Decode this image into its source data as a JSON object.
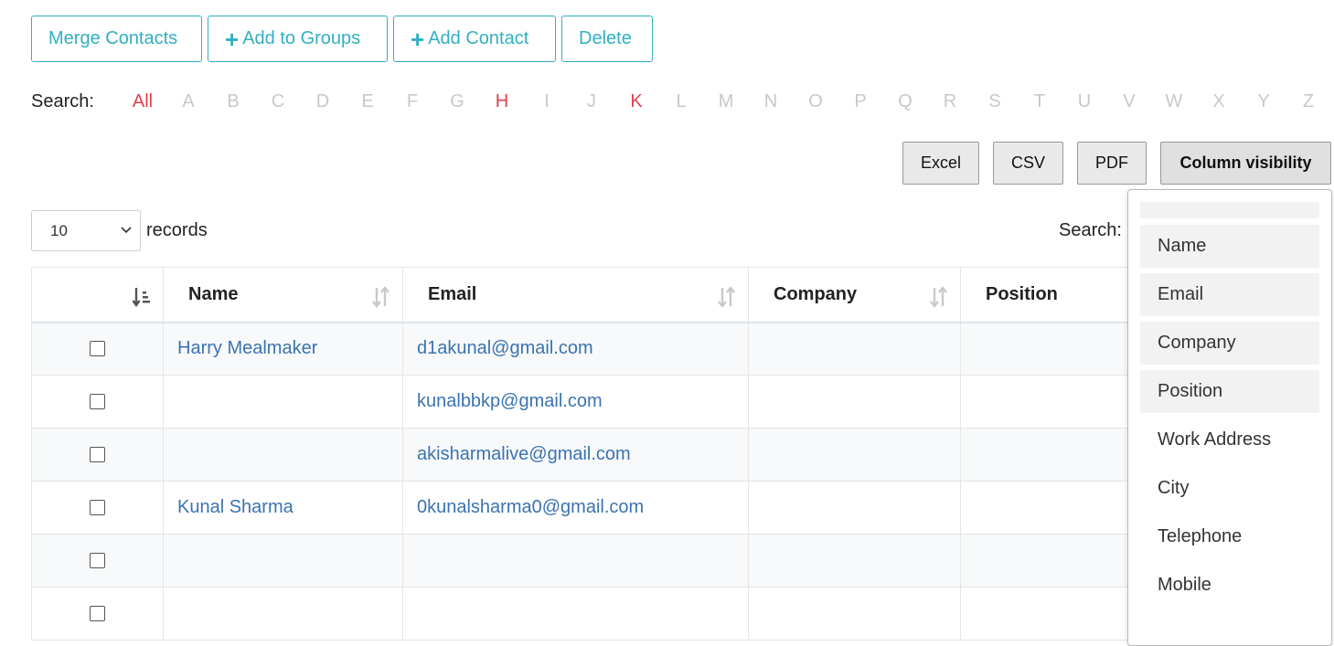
{
  "actions": {
    "merge": "Merge Contacts",
    "add_groups": "Add to Groups",
    "add_contact": "Add Contact",
    "delete": "Delete",
    "plus_glyph": "+"
  },
  "alpha_search": {
    "label": "Search:",
    "letters": [
      "All",
      "A",
      "B",
      "C",
      "D",
      "E",
      "F",
      "G",
      "H",
      "I",
      "J",
      "K",
      "L",
      "M",
      "N",
      "O",
      "P",
      "Q",
      "R",
      "S",
      "T",
      "U",
      "V",
      "W",
      "X",
      "Y",
      "Z"
    ],
    "active": [
      "All",
      "H",
      "K"
    ]
  },
  "export": {
    "excel": "Excel",
    "csv": "CSV",
    "pdf": "PDF",
    "colvis": "Column visibility"
  },
  "length": {
    "value": "10",
    "suffix": "records"
  },
  "table_search": {
    "label": "Search:"
  },
  "table": {
    "columns": [
      "Name",
      "Email",
      "Company",
      "Position"
    ],
    "rows": [
      {
        "name": "Harry Mealmaker",
        "email": "d1akunal@gmail.com",
        "company": "",
        "position": ""
      },
      {
        "name": "",
        "email": "kunalbbkp@gmail.com",
        "company": "",
        "position": ""
      },
      {
        "name": "",
        "email": "akisharmalive@gmail.com",
        "company": "",
        "position": ""
      },
      {
        "name": "Kunal Sharma",
        "email": "0kunalsharma0@gmail.com",
        "company": "",
        "position": ""
      },
      {
        "name": "",
        "email": "",
        "company": "",
        "position": ""
      },
      {
        "name": "",
        "email": "",
        "company": "",
        "position": ""
      }
    ]
  },
  "column_visibility": {
    "items": [
      {
        "label": "Name",
        "visible": true
      },
      {
        "label": "Email",
        "visible": true
      },
      {
        "label": "Company",
        "visible": true
      },
      {
        "label": "Position",
        "visible": true
      },
      {
        "label": "Work Address",
        "visible": false
      },
      {
        "label": "City",
        "visible": false
      },
      {
        "label": "Telephone",
        "visible": false
      },
      {
        "label": "Mobile",
        "visible": false
      }
    ]
  },
  "colors": {
    "accent": "#31b0c2",
    "link": "#3b73b0",
    "alpha_active": "#e0414f",
    "alpha_inactive": "#c8c8c8"
  }
}
